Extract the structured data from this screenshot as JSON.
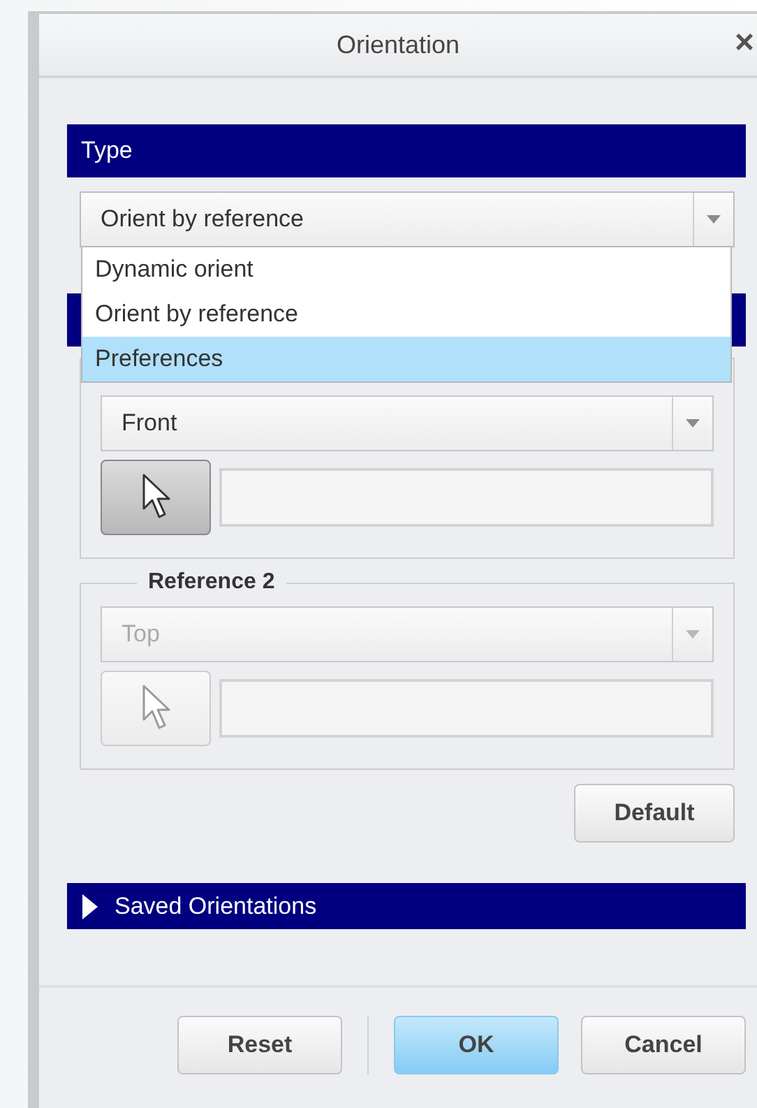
{
  "window": {
    "title": "Orientation",
    "close": "×"
  },
  "type_section": {
    "header": "Type",
    "select": {
      "value": "Orient by reference",
      "expanded": true
    },
    "options": [
      {
        "label": "Dynamic orient",
        "selected": false
      },
      {
        "label": "Orient by reference",
        "selected": false
      },
      {
        "label": "Preferences",
        "selected": true
      }
    ]
  },
  "references": [
    {
      "disabled": false,
      "select_value": "Front",
      "pick_pressed": true
    },
    {
      "legend": "Reference 2",
      "disabled": true,
      "select_value": "Top",
      "pick_pressed": false
    }
  ],
  "default_button": "Default",
  "saved_section": {
    "header": "Saved Orientations",
    "expanded": false
  },
  "footer": {
    "left": [
      {
        "label": "Reset",
        "primary": false
      }
    ],
    "right": [
      {
        "label": "OK",
        "primary": true
      },
      {
        "label": "Cancel",
        "primary": false
      }
    ]
  }
}
